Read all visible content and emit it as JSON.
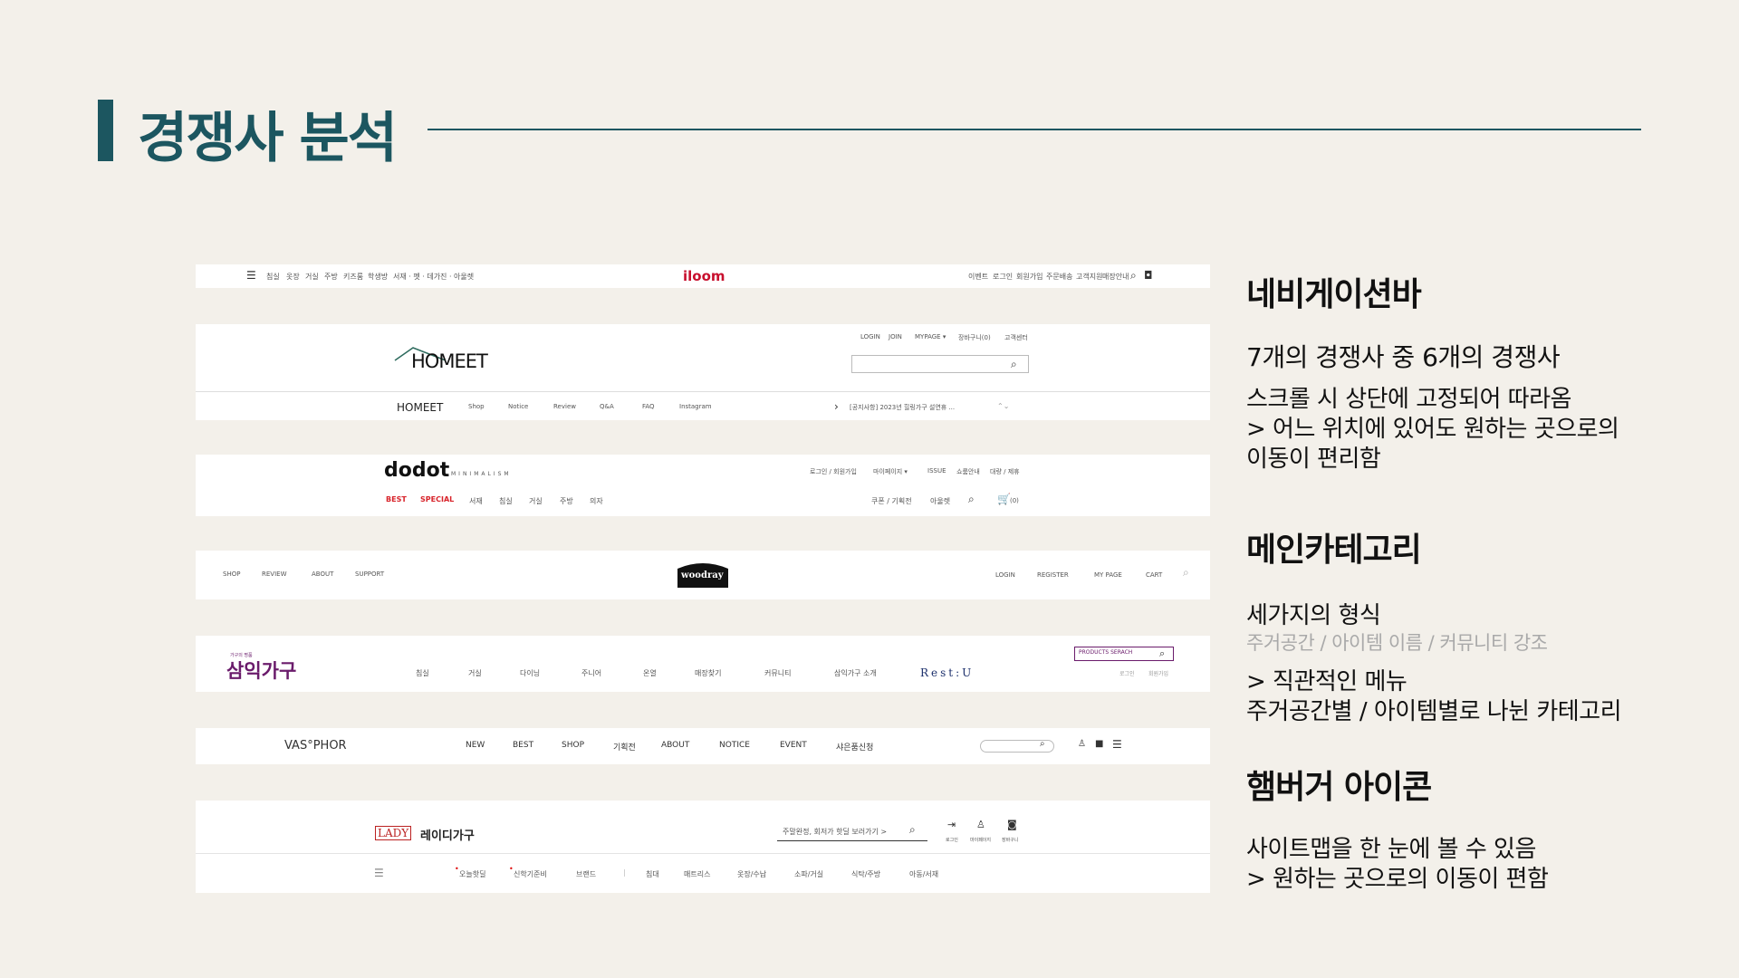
{
  "slide": {
    "title": "경쟁사 분석"
  },
  "iloom": {
    "menu": [
      "침실",
      "옷장",
      "거실",
      "주방",
      "키즈룸",
      "학생방",
      "서재 · 펫 · 데가진 · 아울렛"
    ],
    "logo": "iloom",
    "links": [
      "이벤트",
      "로그인",
      "회원가입",
      "주문배송",
      "고객지원",
      "매장안내"
    ]
  },
  "homeet": {
    "top_links": [
      "LOGIN",
      "JOIN",
      "MYPAGE ▾",
      "장바구니(0)",
      "고객센터"
    ],
    "logo": "HOMEET",
    "nav_brand": "HOMEET",
    "nav": [
      "Shop",
      "Notice",
      "Review",
      "Q&A",
      "FAQ",
      "Instagram"
    ],
    "notice": "[공지사항] 2023년 힐링가구 설연휴 ..."
  },
  "dodot": {
    "logo": "dodot",
    "logo_sub": "MINIMALISM",
    "top_links": [
      "로그인 / 회원가입",
      "마이페이지 ▾",
      "ISSUE",
      "쇼룸안내",
      "대량 / 제휴"
    ],
    "best": "BEST",
    "special": "SPECIAL",
    "menu": [
      "서재",
      "침실",
      "거실",
      "주방",
      "의자"
    ],
    "right": [
      "쿠폰 / 기획전",
      "아울렛"
    ],
    "cart_count": "(0)"
  },
  "woodray": {
    "left": [
      "SHOP",
      "REVIEW",
      "ABOUT",
      "SUPPORT"
    ],
    "logo": "woodray",
    "right": [
      "LOGIN",
      "REGISTER",
      "MY PAGE",
      "CART"
    ]
  },
  "samik": {
    "logo_small": "가구의 명품",
    "logo": "삼익가구",
    "menu": [
      "침실",
      "거실",
      "다이닝",
      "주니어",
      "온열",
      "매장찾기",
      "커뮤니티",
      "삼익가구 소개"
    ],
    "restu": "Rest:U",
    "search": "PRODUCTS SERACH",
    "links": [
      "로그인",
      "회원가입"
    ]
  },
  "vasphor": {
    "logo": "VAS°PHOR",
    "menu": [
      "NEW",
      "BEST",
      "SHOP",
      "기획전",
      "ABOUT",
      "NOTICE",
      "EVENT",
      "샤은품신청"
    ]
  },
  "lady": {
    "logo_box": "LADY",
    "logo": "레이디가구",
    "search": "주말완정, 회저가 핫딜 보러가기 >",
    "icons": [
      "로그인",
      "마이페이지",
      "장바구니"
    ],
    "menu_red": [
      "오늘핫딜",
      "신학기준비"
    ],
    "menu": [
      "브랜드",
      "침대",
      "매트리스",
      "옷장/수납",
      "소파/거실",
      "식탁/주방",
      "아동/서재"
    ]
  },
  "panel": {
    "nav": {
      "heading": "네비게이션바",
      "sub": "7개의 경쟁사 중 6개의 경쟁사",
      "lines": [
        "스크롤 시 상단에 고정되어 따라옴",
        "> 어느 위치에 있어도 원하는 곳으로의",
        "이동이 편리함"
      ]
    },
    "category": {
      "heading": "메인카테고리",
      "line1": "세가지의 형식",
      "muted": "주거공간 / 아이템 이름 / 커뮤니티 강조",
      "line2": "> 직관적인 메뉴",
      "line3": "주거공간별 / 아이템별로 나뉜 카테고리"
    },
    "hamburger": {
      "heading": "햄버거 아이콘",
      "lines": [
        "사이트맵을 한 눈에 볼 수 있음",
        "> 원하는 곳으로의 이동이 편함"
      ]
    }
  },
  "colors": {
    "accent": "#1c5660",
    "background": "#f3f0ea",
    "iloom": "#c8102e",
    "samik": "#6a1b6b",
    "dodot_red": "#d8232a"
  }
}
